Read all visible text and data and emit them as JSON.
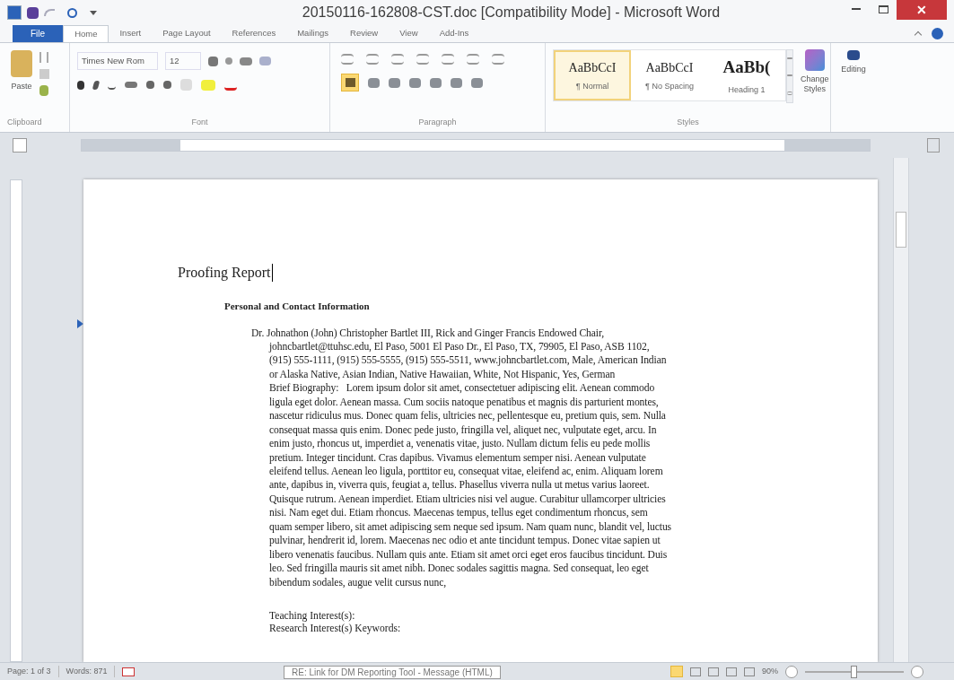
{
  "window": {
    "title": "20150116-162808-CST.doc [Compatibility Mode] - Microsoft Word",
    "close": "✕"
  },
  "tabs": [
    {
      "label": "File",
      "kind": "file",
      "selected": false
    },
    {
      "label": "Home",
      "kind": "tab",
      "selected": true
    },
    {
      "label": "Insert",
      "kind": "tab",
      "selected": false
    },
    {
      "label": "Page Layout",
      "kind": "tab",
      "selected": false
    },
    {
      "label": "References",
      "kind": "tab",
      "selected": false
    },
    {
      "label": "Mailings",
      "kind": "tab",
      "selected": false
    },
    {
      "label": "Review",
      "kind": "tab",
      "selected": false
    },
    {
      "label": "View",
      "kind": "tab",
      "selected": false
    },
    {
      "label": "Add-Ins",
      "kind": "tab",
      "selected": false
    }
  ],
  "ribbon": {
    "paste": "Paste",
    "font_name": "Times New Rom",
    "font_size": "12",
    "groups": [
      "Clipboard",
      "Font",
      "Paragraph",
      "Styles"
    ],
    "styles": [
      {
        "sample": "AaBbCcI",
        "name": "¶ Normal",
        "kind": "normal",
        "selected": true
      },
      {
        "sample": "AaBbCcI",
        "name": "¶ No Spacing",
        "kind": "normal",
        "selected": false
      },
      {
        "sample": "AaBb(",
        "name": "Heading 1",
        "kind": "heading",
        "selected": false
      }
    ],
    "change_styles": "Change Styles",
    "editing": "Editing"
  },
  "document": {
    "title": "Proofing Report",
    "heading": "Personal and Contact Information",
    "lines": [
      "Dr. Johnathon (John) Christopher Bartlet III, Rick and Ginger Francis Endowed Chair,",
      "johncbartlet@ttuhsc.edu, El Paso, 5001 El Paso Dr., El Paso, TX, 79905, El Paso, ASB 1102,",
      "(915) 555-1111, (915) 555-5555, (915) 555-5511, www.johncbartlet.com, Male, American Indian",
      "or Alaska Native, Asian Indian, Native Hawaiian, White, Not Hispanic, Yes, German",
      "Brief Biography:   Lorem ipsum dolor sit amet, consectetuer adipiscing elit. Aenean commodo",
      "ligula eget dolor. Aenean massa. Cum sociis natoque penatibus et magnis dis parturient montes,",
      "nascetur ridiculus mus. Donec quam felis, ultricies nec, pellentesque eu, pretium quis, sem. Nulla",
      "consequat massa quis enim. Donec pede justo, fringilla vel, aliquet nec, vulputate eget, arcu. In",
      "enim justo, rhoncus ut, imperdiet a, venenatis vitae, justo. Nullam dictum felis eu pede mollis",
      "pretium. Integer tincidunt. Cras dapibus. Vivamus elementum semper nisi. Aenean vulputate",
      "eleifend tellus. Aenean leo ligula, porttitor eu, consequat vitae, eleifend ac, enim. Aliquam lorem",
      "ante, dapibus in, viverra quis, feugiat a, tellus. Phasellus viverra nulla ut metus varius laoreet.",
      "Quisque rutrum. Aenean imperdiet. Etiam ultricies nisi vel augue. Curabitur ullamcorper ultricies",
      "nisi. Nam eget dui. Etiam rhoncus. Maecenas tempus, tellus eget condimentum rhoncus, sem",
      "quam semper libero, sit amet adipiscing sem neque sed ipsum. Nam quam nunc, blandit vel, luctus",
      "pulvinar, hendrerit id, lorem. Maecenas nec odio et ante tincidunt tempus. Donec vitae sapien ut",
      "libero venenatis faucibus. Nullam quis ante. Etiam sit amet orci eget eros faucibus tincidunt. Duis",
      "leo. Sed fringilla mauris sit amet nibh. Donec sodales sagittis magna. Sed consequat, leo eget",
      "bibendum sodales, augue velit cursus nunc,"
    ],
    "after": [
      "Teaching Interest(s):",
      "Research Interest(s) Keywords:"
    ]
  },
  "status_bar": {
    "page": "Page: 1 of 3",
    "words": "Words: 871",
    "zoom": "90%",
    "level": 0.5
  },
  "taskbar_tooltip": "RE: Link for DM Reporting Tool - Message (HTML)"
}
